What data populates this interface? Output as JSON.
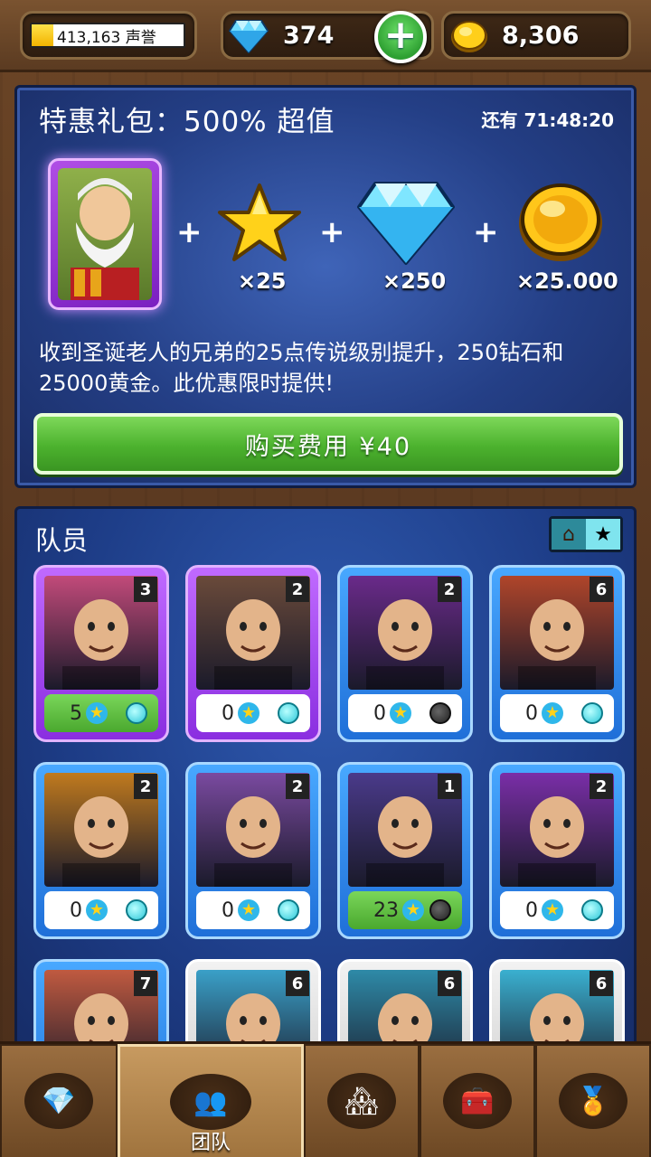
{
  "header": {
    "reputation_text": "413,163 声誉",
    "gems": "374",
    "gold": "8,306",
    "add_label": "+"
  },
  "offer": {
    "title": "特惠礼包：500% 超值",
    "timer": "还有 71:48:20",
    "plus": "+",
    "rewards": [
      {
        "icon": "star-icon",
        "label": "×25"
      },
      {
        "icon": "diamond-icon",
        "label": "×250"
      },
      {
        "icon": "gold-coin-icon",
        "label": "×25.000"
      }
    ],
    "description": "收到圣诞老人的兄弟的25点传说级别提升，250钻石和25000黄金。此优惠限时提供!",
    "buy_label": "购买费用 ¥40"
  },
  "team": {
    "title": "队员",
    "sort": [
      "⌂",
      "★"
    ],
    "members": [
      {
        "level": "3",
        "stars": "5",
        "frame": "purple",
        "status": "cyan",
        "highlight": true,
        "color": "#c24a7a"
      },
      {
        "level": "2",
        "stars": "0",
        "frame": "purple",
        "status": "cyan",
        "highlight": false,
        "color": "#6a4a3a"
      },
      {
        "level": "2",
        "stars": "0",
        "frame": "blue",
        "status": "dark",
        "highlight": false,
        "color": "#6a2a8a"
      },
      {
        "level": "6",
        "stars": "0",
        "frame": "blue",
        "status": "cyan",
        "highlight": false,
        "color": "#b0452a"
      },
      {
        "level": "2",
        "stars": "0",
        "frame": "blue",
        "status": "cyan",
        "highlight": false,
        "color": "#c07a1e"
      },
      {
        "level": "2",
        "stars": "0",
        "frame": "blue",
        "status": "cyan",
        "highlight": false,
        "color": "#7a4aa0"
      },
      {
        "level": "1",
        "stars": "23",
        "frame": "blue",
        "status": "dark",
        "highlight": true,
        "color": "#4a3a8a"
      },
      {
        "level": "2",
        "stars": "0",
        "frame": "blue",
        "status": "cyan",
        "highlight": false,
        "color": "#7a2ea8"
      },
      {
        "level": "7",
        "stars": "",
        "frame": "blue",
        "status": "",
        "highlight": false,
        "color": "#c05a40"
      },
      {
        "level": "6",
        "stars": "",
        "frame": "white",
        "status": "",
        "highlight": false,
        "color": "#3aa0c8"
      },
      {
        "level": "6",
        "stars": "",
        "frame": "white",
        "status": "",
        "highlight": false,
        "color": "#2e8aa8"
      },
      {
        "level": "6",
        "stars": "",
        "frame": "white",
        "status": "",
        "highlight": false,
        "color": "#3ab0d0"
      }
    ]
  },
  "nav": {
    "tabs": [
      {
        "icon": "diamond-shop-icon",
        "glyph": "💎",
        "label": ""
      },
      {
        "icon": "team-icon",
        "glyph": "👥",
        "label": "团队"
      },
      {
        "icon": "town-icon",
        "glyph": "🏘",
        "label": ""
      },
      {
        "icon": "treasure-chest-icon",
        "glyph": "🧰",
        "label": ""
      },
      {
        "icon": "achievement-medal-icon",
        "glyph": "🏅",
        "label": ""
      }
    ]
  }
}
